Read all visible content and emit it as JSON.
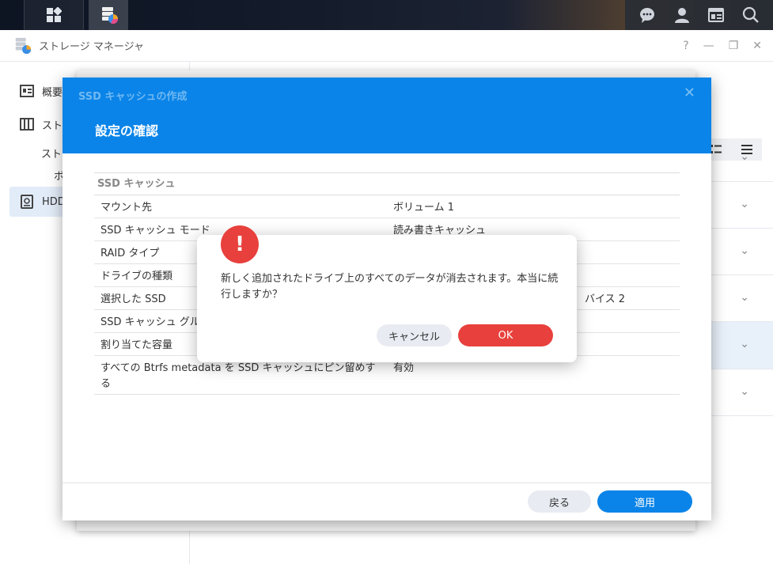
{
  "window": {
    "title": "ストレージ マネージャ",
    "controls": {
      "help": "?",
      "minimize": "—",
      "restore": "❐",
      "close": "✕"
    }
  },
  "sidebar": {
    "items": [
      {
        "label": "概要"
      },
      {
        "label": "スト"
      },
      {
        "label": "スト"
      },
      {
        "label": "ボ"
      },
      {
        "label": "HDD"
      }
    ]
  },
  "wizard": {
    "title": "SSD キャッシュの作成",
    "step_title": "設定の確認",
    "section": "SSD キャッシュ",
    "rows": [
      {
        "key": "マウント先",
        "value": "ボリューム 1"
      },
      {
        "key": "SSD キャッシュ モード",
        "value": "読み書きキャッシュ"
      },
      {
        "key": "RAID タイプ",
        "value": ""
      },
      {
        "key": "ドライブの種類",
        "value": ""
      },
      {
        "key": "選択した SSD",
        "value": "バイス 2"
      },
      {
        "key": "SSD キャッシュ グル",
        "value": ""
      },
      {
        "key": "割り当てた容量",
        "value": ""
      },
      {
        "key": "すべての Btrfs metadata を SSD キャッシュにピン留めする",
        "value": "有効"
      }
    ],
    "back": "戻る",
    "apply": "適用"
  },
  "confirm": {
    "icon": "!",
    "message": "新しく追加されたドライブ上のすべてのデータが消去されます。本当に続行しますか？",
    "cancel": "キャンセル",
    "ok": "OK"
  },
  "colors": {
    "accent": "#0a84e8",
    "danger": "#e8403c"
  }
}
